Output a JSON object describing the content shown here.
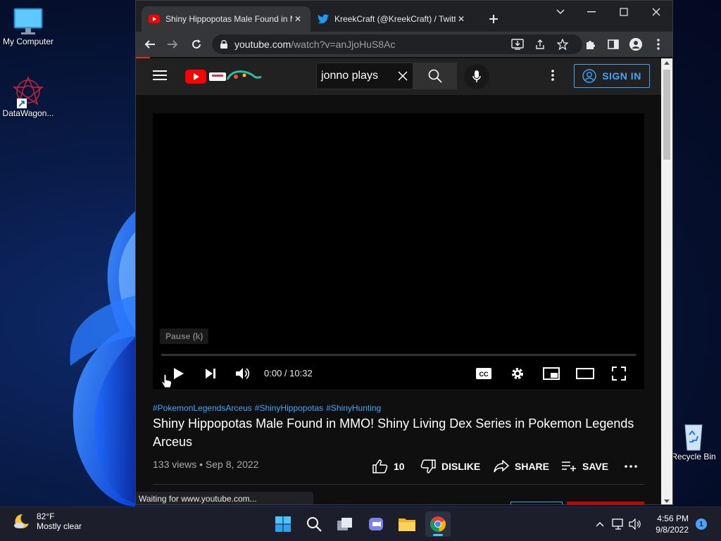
{
  "desktop": {
    "icons": [
      {
        "label": "My Computer"
      },
      {
        "label": "DataWagon..."
      }
    ],
    "recycle_bin_label": "Recycle Bin"
  },
  "browser": {
    "tabs": [
      {
        "title": "Shiny Hippopotas Male Found in MMO! Shiny Living Dex Series in Pokemon Legends Arceus - YouTube",
        "active": true
      },
      {
        "title": "KreekCraft (@KreekCraft) / Twitter",
        "active": false
      }
    ],
    "url_host": "youtube.com",
    "url_path": "/watch?v=anJjoHuS8Ac",
    "status_text": "Waiting for www.youtube.com..."
  },
  "youtube": {
    "search_query": "jonno plays",
    "sign_in_label": "SIGN IN",
    "player": {
      "tooltip": "Pause (k)",
      "time": "0:00 / 10:32",
      "progress_fraction": 0.0
    },
    "video": {
      "hashtags": [
        "#PokemonLegendsArceus",
        "#ShinyHippopotas",
        "#ShinyHunting"
      ],
      "title": "Shiny Hippopotas Male Found in MMO! Shiny Living Dex Series in Pokemon Legends Arceus",
      "meta": "133 views • Sep 8, 2022",
      "likes": "10",
      "dislike_label": "DISLIKE",
      "share_label": "SHARE",
      "save_label": "SAVE"
    }
  },
  "taskbar": {
    "weather_temp": "82°F",
    "weather_desc": "Mostly clear",
    "time": "4:56 PM",
    "date": "9/8/2022",
    "notification_count": "1"
  },
  "colors": {
    "accent_blue": "#3ea6ff",
    "yt_red": "#ff0000",
    "chrome_dark": "#202124"
  }
}
